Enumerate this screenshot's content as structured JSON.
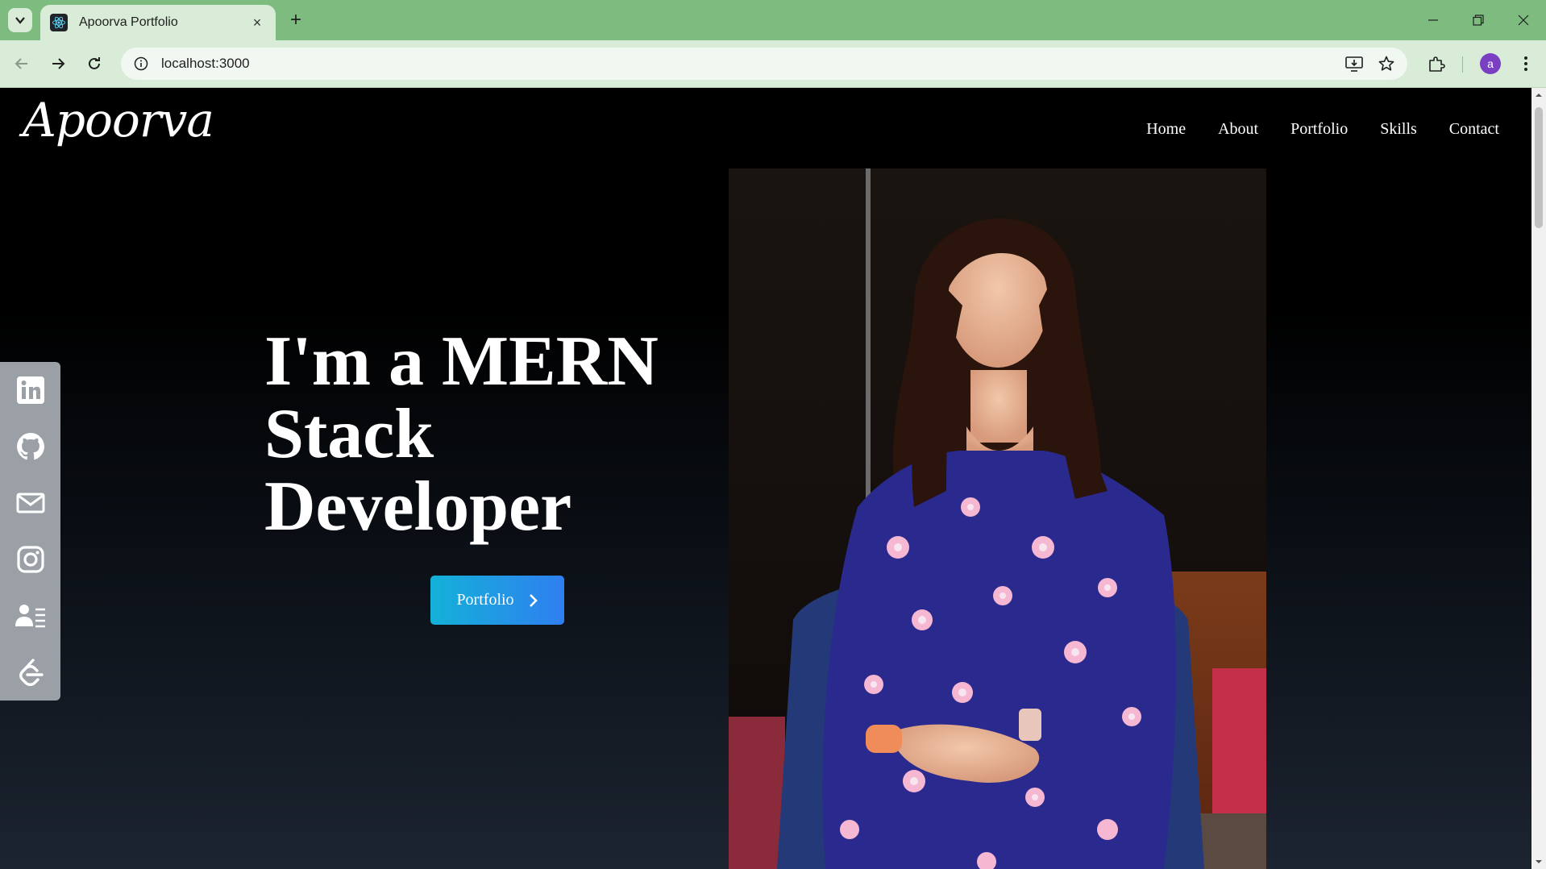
{
  "browser": {
    "tab_title": "Apoorva Portfolio",
    "tab_close": "×",
    "new_tab": "+",
    "url": "localhost:3000",
    "profile_initial": "a"
  },
  "site": {
    "logo": "Apoorva",
    "nav": [
      "Home",
      "About",
      "Portfolio",
      "Skills",
      "Contact"
    ],
    "hero_lines": [
      "I'm a MERN",
      "Stack",
      "Developer"
    ],
    "cta_label": "Portfolio",
    "social_icons": [
      "linkedin-icon",
      "github-icon",
      "mail-icon",
      "instagram-icon",
      "resume-icon",
      "leetcode-icon"
    ]
  },
  "colors": {
    "chrome_tabbar": "#7dbb7f",
    "chrome_toolbar": "#d8ecd8",
    "page_bg": "#000000",
    "cta_gradient_start": "#14b1d8",
    "cta_gradient_end": "#2f7ff0",
    "social_bar": "#9aa0a6",
    "dress_blue": "#2a2a8e"
  }
}
